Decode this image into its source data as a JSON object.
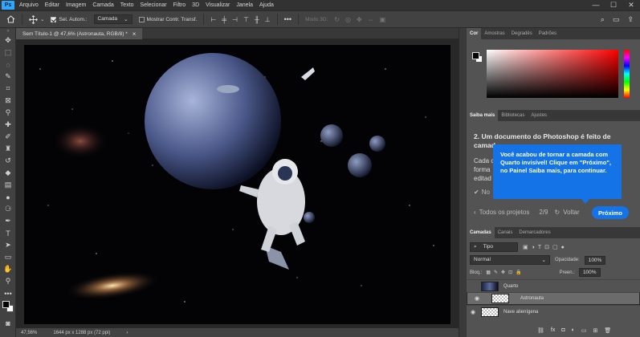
{
  "app": {
    "logo": "Ps"
  },
  "menu": [
    "Arquivo",
    "Editar",
    "Imagem",
    "Camada",
    "Texto",
    "Selecionar",
    "Filtro",
    "3D",
    "Visualizar",
    "Janela",
    "Ajuda"
  ],
  "window_controls": [
    "—",
    "☐",
    "✕"
  ],
  "options": {
    "auto_select_label": "Sel. Autom.:",
    "auto_select_value": "Camada",
    "show_transform_label": "Mostrar Contr. Transf.",
    "mode_3d_label": "Modo 3D:"
  },
  "document": {
    "tab_title": "Sem Título-1 @ 47,6% (Astronauta, RGB/8) *",
    "close_glyph": "×"
  },
  "status": {
    "zoom": "47,56%",
    "dimensions": "1644 px x 1288 px (72 ppi)"
  },
  "color_panel": {
    "tabs": [
      "Cor",
      "Amostras",
      "Degradês",
      "Padrões"
    ],
    "accent": "#ff0000"
  },
  "learn_panel": {
    "tabs": [
      "Saiba mais",
      "Bibliotecas",
      "Ajustes"
    ],
    "heading": "2.  Um documento do Photoshop é feito de camad",
    "body_line1": "Cada c",
    "body_line2": "forma",
    "body_line3": "editad",
    "checkbox_label": "No",
    "tooltip": "Você acabou de tornar a camada com Quarto invisível! Clique em \"Próximo\", no Painel Saiba mais, para continuar.",
    "all_projects": "Todos os projetos",
    "step": "2/9",
    "back": "Voltar",
    "next": "Próximo"
  },
  "layers_panel": {
    "tabs": [
      "Camadas",
      "Canais",
      "Demarcadores"
    ],
    "filter_kind": "Tipo",
    "blend_mode": "Normal",
    "opacity_label": "Opacidade:",
    "opacity_value": "100%",
    "lock_label": "Bloq.:",
    "fill_label": "Preen.:",
    "fill_value": "100%",
    "layers": [
      {
        "name": "Quarto",
        "visible": false,
        "selected": false
      },
      {
        "name": "Astronauta",
        "visible": true,
        "selected": true
      },
      {
        "name": "Nave alienígena",
        "visible": true,
        "selected": false
      }
    ],
    "footer_icons": [
      "link-icon",
      "fx-icon",
      "mask-icon",
      "adjustment-icon",
      "group-icon",
      "new-layer-icon",
      "trash-icon"
    ]
  }
}
